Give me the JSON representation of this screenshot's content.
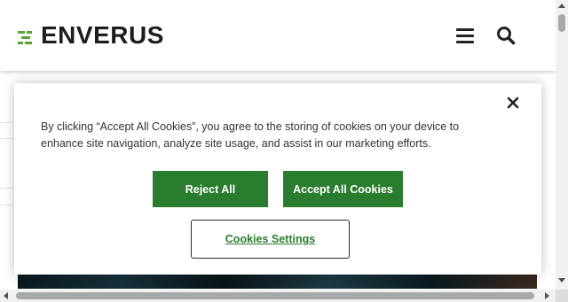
{
  "header": {
    "logo_text": "ENVERUS",
    "brand_color": "#5aa531",
    "menu_icon": "hamburger-menu-icon",
    "search_icon": "search-icon"
  },
  "cookie_banner": {
    "message": "By clicking “Accept All Cookies”, you agree to the storing of cookies on your device to enhance site navigation, analyze site usage, and assist in our marketing efforts.",
    "reject_label": "Reject All",
    "accept_label": "Accept All Cookies",
    "settings_label": "Cookies Settings",
    "close_icon": "close-icon",
    "button_color": "#2a7d2e"
  }
}
